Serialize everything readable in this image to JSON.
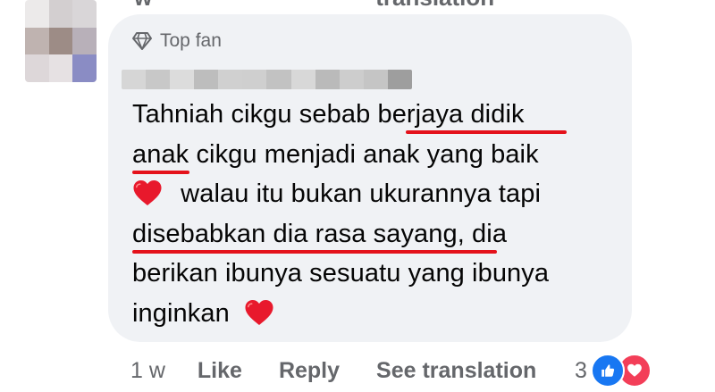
{
  "top_strip": {
    "left_text": "w",
    "right_text": "translation"
  },
  "avatar": {
    "tiles": [
      "#eceaea",
      "#d3cfd0",
      "#d9d6d8",
      "#bfb3b0",
      "#9d8c86",
      "#b8b0b9",
      "#ddd7d9",
      "#e6e1e3",
      "#8a8cc4"
    ]
  },
  "badge": {
    "icon": "diamond-icon",
    "label": "Top fan"
  },
  "name_bar": {
    "tiles": [
      "#d6d6d6",
      "#c8c8c8",
      "#dcdcdc",
      "#bdbdbd",
      "#d0d0d0",
      "#cfcfcf",
      "#c2c2c2",
      "#d8d8d8",
      "#bababa",
      "#cdcdcd",
      "#c5c5c5",
      "#9e9e9e"
    ]
  },
  "comment": {
    "lines": [
      "Tahniah cikgu sebab berjaya didik",
      "anak cikgu menjadi anak yang baik",
      "walau itu bukan ukurannya tapi",
      "disebabkan dia rasa sayang, dia",
      "berikan ibunya sesuatu yang ibunya",
      "inginkan"
    ],
    "underline_color": "#e4121b",
    "heart_color": "#e8192c"
  },
  "actions": {
    "time": "1 w",
    "like": "Like",
    "reply": "Reply",
    "see_translation": "See translation"
  },
  "reactions": {
    "count": "3",
    "icons": [
      "like-icon",
      "love-icon"
    ],
    "like_color": "#1877f2",
    "love_color": "#f33e58"
  }
}
